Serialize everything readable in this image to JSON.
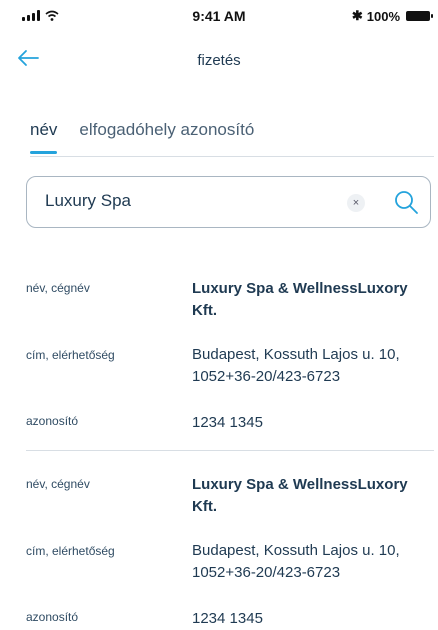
{
  "status_bar": {
    "time": "9:41 AM",
    "battery_percent": "100%"
  },
  "header": {
    "title": "fizetés",
    "back_icon": "arrow-left-icon"
  },
  "tabs": [
    {
      "label": "név",
      "active": true
    },
    {
      "label": "elfogadóhely azonosító",
      "active": false
    }
  ],
  "search": {
    "value": "Luxury Spa",
    "clear_label": "×",
    "icon": "search-icon"
  },
  "results": [
    {
      "name_label": "név, cégnév",
      "name_value": "Luxury Spa & WellnessLuxory Kft.",
      "address_label": "cím, elérhetőség",
      "address_value": "Budapest, Kossuth Lajos u. 10, 1052+36-20/423-6723",
      "id_label": "azonosító",
      "id_value": "1234 1345"
    },
    {
      "name_label": "név, cégnév",
      "name_value": "Luxury Spa & WellnessLuxory Kft.",
      "address_label": "cím, elérhetőség",
      "address_value": "Budapest, Kossuth Lajos u. 10, 1052+36-20/423-6723",
      "id_label": "azonosító",
      "id_value": "1234 1345"
    }
  ],
  "colors": {
    "accent": "#24a3dc",
    "text": "#1f3a52",
    "border": "#a9b6c2",
    "divider": "#d8dee4"
  }
}
